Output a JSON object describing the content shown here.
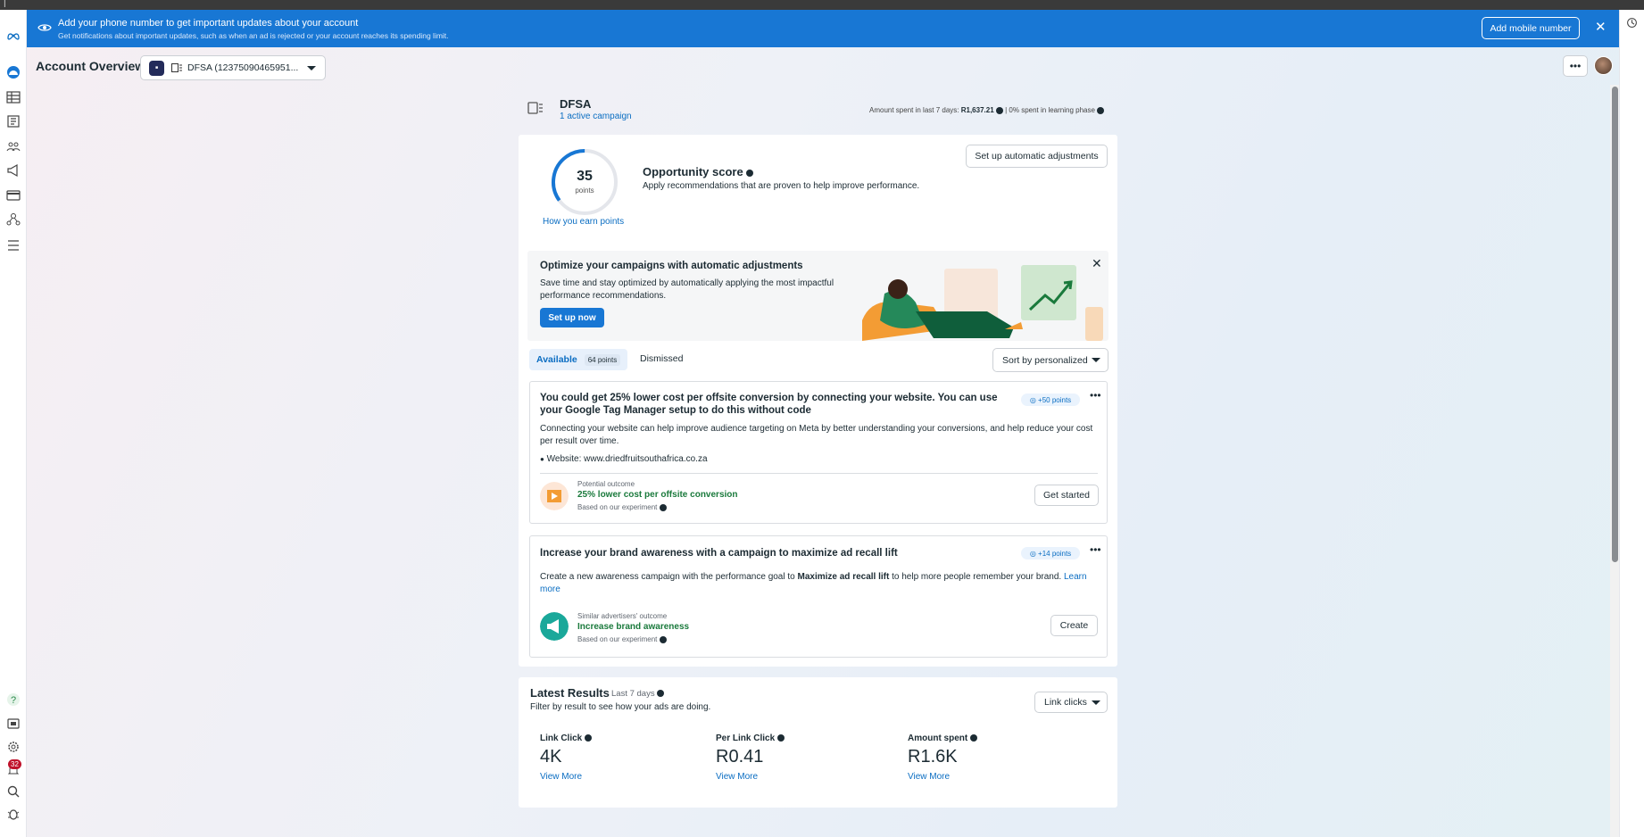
{
  "window": {
    "title_fragment": "|"
  },
  "banner": {
    "title": "Add your phone number to get important updates about your account",
    "subtitle": "Get notifications about important updates, such as when an ad is rejected or your account reaches its spending limit.",
    "button": "Add mobile number",
    "close": "✕"
  },
  "header": {
    "title": "Account Overview",
    "account_selector": "DFSA (12375090465951...",
    "more": "•••"
  },
  "nav": {
    "notification_count": "32",
    "help": "?"
  },
  "campaign": {
    "name": "DFSA",
    "link": "1 active campaign",
    "spent_label": "Amount spent in last 7 days:",
    "spent_value": "R1,637.21",
    "learning": "| 0% spent in learning phase"
  },
  "opportunity": {
    "score": "35",
    "score_unit": "points",
    "score_fraction": 0.35,
    "earn_link": "How you earn points",
    "title": "Opportunity score",
    "description": "Apply recommendations that are proven to help improve performance.",
    "auto_button": "Set up automatic adjustments"
  },
  "promo": {
    "title": "Optimize your campaigns with automatic adjustments",
    "description": "Save time and stay optimized by automatically applying the most impactful performance recommendations.",
    "button": "Set up now",
    "close": "✕"
  },
  "tabs": {
    "available": "Available",
    "available_points": "64 points",
    "dismissed": "Dismissed",
    "sort": "Sort by personalized"
  },
  "recommendations": [
    {
      "title": "You could get 25% lower cost per offsite conversion by connecting your website. You can use your Google Tag Manager setup to do this without code",
      "points": "+50 points",
      "description": "Connecting your website can help improve audience targeting on Meta by better understanding your conversions, and help reduce your cost per result over time.",
      "website": "Website: www.driedfruitsouthafrica.co.za",
      "outcome_label": "Potential outcome",
      "outcome": "25% lower cost per offsite conversion",
      "basis": "Based on our experiment",
      "button": "Get started"
    },
    {
      "title": "Increase your brand awareness with a campaign to maximize ad recall lift",
      "points": "+14 points",
      "description_pre": "Create a new awareness campaign with the performance goal to ",
      "description_bold": "Maximize ad recall lift",
      "description_post": " to help more people remember your brand. ",
      "learn_more": "Learn more",
      "outcome_label": "Similar advertisers' outcome",
      "outcome": "Increase brand awareness",
      "basis": "Based on our experiment",
      "button": "Create"
    }
  ],
  "latest": {
    "title": "Latest Results",
    "period": "Last 7 days",
    "description": "Filter by result to see how your ads are doing.",
    "select": "Link clicks",
    "metrics": [
      {
        "label": "Link Click",
        "value": "4K",
        "link": "View More"
      },
      {
        "label": "Per Link Click",
        "value": "R0.41",
        "link": "View More"
      },
      {
        "label": "Amount spent",
        "value": "R1.6K",
        "link": "View More"
      }
    ]
  },
  "colors": {
    "brand": "#1877d4",
    "link": "#0a6dc2",
    "positive": "#1a7a3c"
  }
}
